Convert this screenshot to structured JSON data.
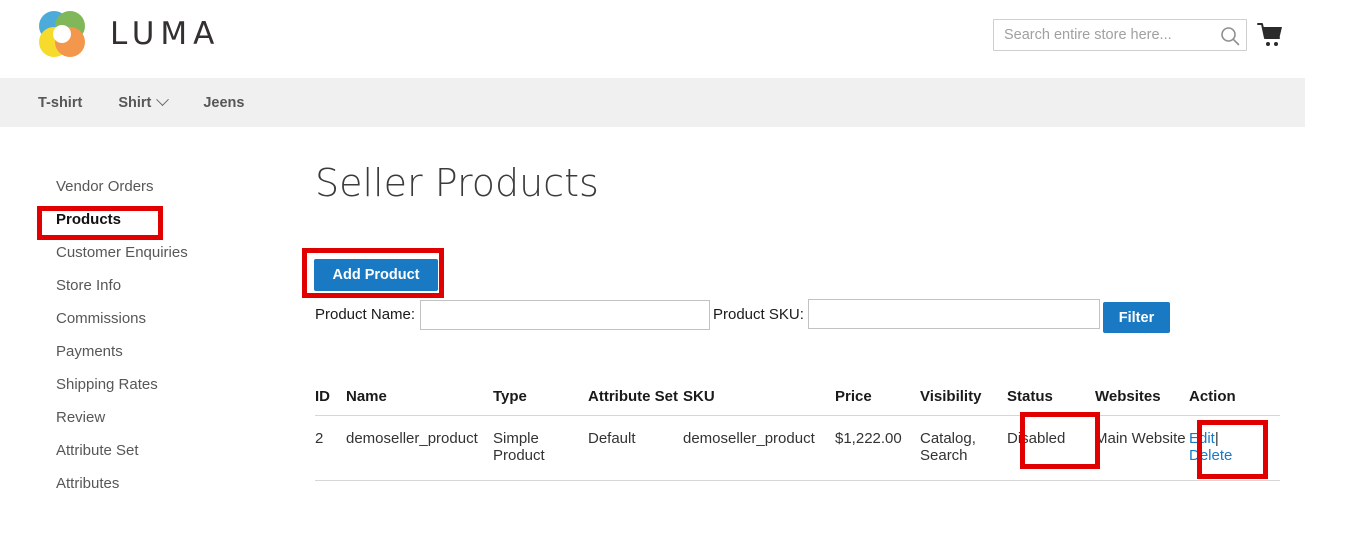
{
  "header": {
    "brand": "LUMA",
    "logo_icon": "luma-flower-logo",
    "logo_colors": {
      "blue": "#2f9dd4",
      "green": "#6aab3c",
      "yellow": "#f5d508",
      "orange": "#f0862c"
    },
    "search": {
      "placeholder": "Search entire store here...",
      "value": "",
      "icon": "search-icon"
    },
    "cart_icon": "shopping-cart-icon"
  },
  "nav": {
    "items": [
      {
        "label": "T-shirt",
        "has_dropdown": false
      },
      {
        "label": "Shirt",
        "has_dropdown": true
      },
      {
        "label": "Jeens",
        "has_dropdown": false
      }
    ]
  },
  "sidebar": {
    "items": [
      {
        "label": "Vendor Orders",
        "active": false
      },
      {
        "label": "Products",
        "active": true
      },
      {
        "label": "Customer Enquiries",
        "active": false
      },
      {
        "label": "Store Info",
        "active": false
      },
      {
        "label": "Commissions",
        "active": false
      },
      {
        "label": "Payments",
        "active": false
      },
      {
        "label": "Shipping Rates",
        "active": false
      },
      {
        "label": "Review",
        "active": false
      },
      {
        "label": "Attribute Set",
        "active": false
      },
      {
        "label": "Attributes",
        "active": false
      }
    ]
  },
  "main": {
    "title": "Seller Products",
    "add_product_label": "Add Product",
    "filter": {
      "product_name_label": "Product Name:",
      "product_name_value": "",
      "product_sku_label": "Product SKU:",
      "product_sku_value": "",
      "filter_button_label": "Filter"
    },
    "table": {
      "headers": [
        "ID",
        "Name",
        "Type",
        "Attribute Set",
        "SKU",
        "Price",
        "Visibility",
        "Status",
        "Websites",
        "Action"
      ],
      "rows": [
        {
          "id": "2",
          "name": "demoseller_product",
          "type": "Simple Product",
          "attribute_set": "Default",
          "sku": "demoseller_product",
          "price": "$1,222.00",
          "visibility": "Catalog, Search",
          "status": "Disabled",
          "websites": "Main Website",
          "action_edit": "Edit",
          "action_separator": "|",
          "action_delete": "Delete"
        }
      ]
    }
  },
  "annotations": {
    "highlight_color": "#e00000",
    "boxes": [
      "sidebar-products",
      "add-product-button",
      "row-status-cell",
      "row-action-cell"
    ]
  },
  "theme": {
    "accent_blue": "#1979c3",
    "nav_background": "#f0f0f0",
    "text_dark": "#333333",
    "text_muted": "#575757"
  }
}
